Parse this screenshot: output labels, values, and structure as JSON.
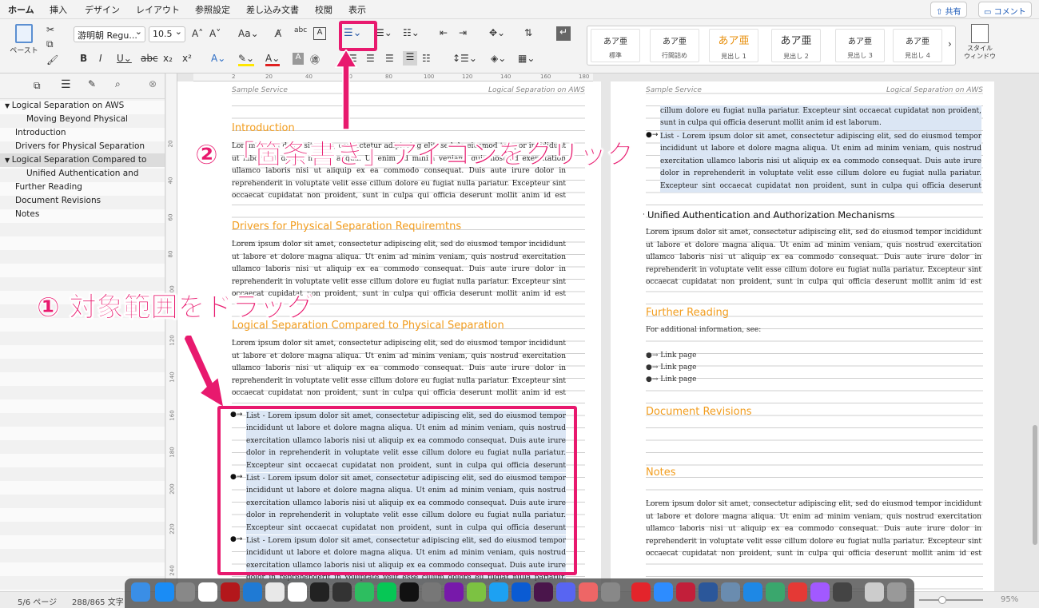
{
  "ribbon_tabs": [
    "ホーム",
    "挿入",
    "デザイン",
    "レイアウト",
    "参照設定",
    "差し込み文書",
    "校閲",
    "表示"
  ],
  "share_label": "共有",
  "comment_label": "コメント",
  "paste_label": "ペースト",
  "font_name": "游明朝 Regu...",
  "font_size": "10.5",
  "style_window_label": "スタイル\nウィンドウ",
  "styles": [
    {
      "sample": "あア亜",
      "name": "標準"
    },
    {
      "sample": "あア亜",
      "name": "行間詰め"
    },
    {
      "sample": "あア亜",
      "name": "見出し 1"
    },
    {
      "sample": "あア亜",
      "name": "見出し 2"
    },
    {
      "sample": "あア亜",
      "name": "見出し 3"
    },
    {
      "sample": "あア亜",
      "name": "見出し 4"
    }
  ],
  "nav": [
    "Logical Separation on AWS",
    "Moving Beyond Physical",
    "Introduction",
    "Drivers for Physical Separation",
    "Logical Separation Compared to",
    "Unified Authentication and",
    "Further Reading",
    "Document Revisions",
    "Notes"
  ],
  "ruler_h": [
    "2",
    "20",
    "40",
    "60",
    "80",
    "100",
    "120",
    "140",
    "160",
    "180"
  ],
  "ruler_v": [
    "20",
    "40",
    "60",
    "80",
    "100",
    "120",
    "140",
    "160",
    "180",
    "200",
    "220",
    "240"
  ],
  "page1": {
    "header_left": "Sample Service",
    "header_right": "Logical Separation on AWS",
    "h_intro": "Introduction",
    "p_intro": "Lorem ipsum dolor sit amet, consectetur adipiscing elit, sed do eiusmod tempor incididunt ut labore et dolore magna aliqua. Ut enim ad minim veniam, quis nostrud exercitation ullamco laboris nisi ut aliquip ex ea commodo consequat. Duis aute irure dolor in reprehenderit in voluptate velit esse cillum dolore eu fugiat nulla pariatur. Excepteur sint occaecat cupidatat non proident, sunt in culpa qui officia deserunt mollit anim id est laborum.",
    "h_drivers": "Drivers for Physical Separation Requiremtns",
    "p_drivers": "Lorem ipsum dolor sit amet, consectetur adipiscing elit, sed do eiusmod tempor incididunt ut labore et dolore magna aliqua. Ut enim ad minim veniam, quis nostrud exercitation ullamco laboris nisi ut aliquip ex ea commodo consequat. Duis aute irure dolor in reprehenderit in voluptate velit esse cillum dolore eu fugiat nulla pariatur. Excepteur sint occaecat cupidatat non proident, sunt in culpa qui officia deserunt mollit anim id est laborum.",
    "h_logical": "Logical Separation Compared to Physical Separation",
    "p_logical": "Lorem ipsum dolor sit amet, consectetur adipiscing elit, sed do eiusmod tempor incididunt ut labore et dolore magna aliqua. Ut enim ad minim veniam, quis nostrud exercitation ullamco laboris nisi ut aliquip ex ea commodo consequat. Duis aute irure dolor in reprehenderit in voluptate velit esse cillum dolore eu fugiat nulla pariatur. Excepteur sint occaecat cupidatat non proident, sunt in culpa qui officia deserunt mollit anim id est laborum.",
    "list_item": "List - Lorem ipsum dolor sit amet, consectetur adipiscing elit, sed do eiusmod tempor incididunt ut labore et dolore magna aliqua. Ut enim ad minim veniam, quis nostrud exercitation ullamco laboris nisi ut aliquip ex ea commodo consequat. Duis aute irure dolor in reprehenderit in voluptate velit esse cillum dolore eu fugiat nulla pariatur. Excepteur sint occaecat cupidatat non proident, sunt in culpa qui officia deserunt mollit anim id est laborum."
  },
  "page2": {
    "header_left": "Sample Service",
    "header_right": "Logical Separation on AWS",
    "top_list_tail": "cillum dolore eu fugiat nulla pariatur. Excepteur sint occaecat cupidatat non proident, sunt in culpa qui officia deserunt mollit anim id est laborum.",
    "top_list_item": "List - Lorem ipsum dolor sit amet, consectetur adipiscing elit, sed do eiusmod tempor incididunt ut labore et dolore magna aliqua. Ut enim ad minim veniam, quis nostrud exercitation ullamco laboris nisi ut aliquip ex ea commodo consequat. Duis aute irure dolor in reprehenderit in voluptate velit esse cillum dolore eu fugiat nulla pariatur. Excepteur sint occaecat cupidatat non proident, sunt in culpa qui officia deserunt mollit anim id est laborum.",
    "h_unified": "Unified Authentication and Authorization Mechanisms",
    "p_unified": "Lorem ipsum dolor sit amet, consectetur adipiscing elit, sed do eiusmod tempor incididunt ut labore et dolore magna aliqua. Ut enim ad minim veniam, quis nostrud exercitation ullamco laboris nisi ut aliquip ex ea commodo consequat. Duis aute irure dolor in reprehenderit in voluptate velit esse cillum dolore eu fugiat nulla pariatur. Excepteur sint occaecat cupidatat non proident, sunt in culpa qui officia deserunt mollit anim id est laborum.",
    "h_further": "Further Reading",
    "p_further": "For additional information, see:",
    "links": [
      "Link page",
      "Link page",
      "Link page"
    ],
    "h_revisions": "Document Revisions",
    "h_notes": "Notes",
    "p_notes": "Lorem ipsum dolor sit amet, consectetur adipiscing elit, sed do eiusmod tempor incididunt ut labore et dolore magna aliqua. Ut enim ad minim veniam, quis nostrud exercitation ullamco laboris nisi ut aliquip ex ea commodo consequat. Duis aute irure dolor in reprehenderit in voluptate velit esse cillum dolore eu fugiat nulla pariatur. Excepteur sint occaecat cupidatat non proident, sunt in culpa qui officia deserunt mollit anim id est laborum."
  },
  "annotations": {
    "step1": "① 対象範囲をドラッグ",
    "step2": "② 「箇条書き」アイコンをクリック",
    "color": "#e8196e"
  },
  "status": {
    "page": "5/6 ページ",
    "words": "288/865 文字",
    "zoom": "95%"
  }
}
